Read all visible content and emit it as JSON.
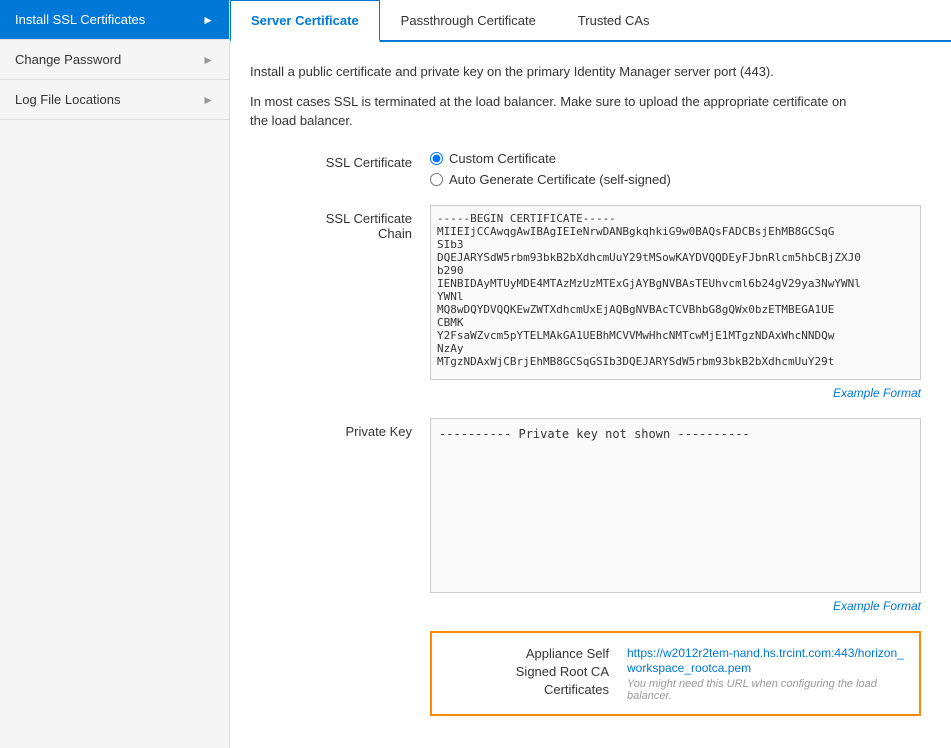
{
  "sidebar": {
    "items": [
      {
        "label": "Install SSL Certificates",
        "active": true
      },
      {
        "label": "Change Password",
        "active": false
      },
      {
        "label": "Log File Locations",
        "active": false
      }
    ]
  },
  "tabs": [
    {
      "label": "Server Certificate",
      "active": true
    },
    {
      "label": "Passthrough Certificate",
      "active": false
    },
    {
      "label": "Trusted CAs",
      "active": false
    }
  ],
  "description": {
    "line1": "Install a public certificate and private key on the primary Identity Manager server port (443).",
    "line2": "In most cases SSL is terminated at the load balancer. Make sure to upload the appropriate certificate on the load balancer."
  },
  "form": {
    "ssl_certificate_label": "SSL Certificate",
    "radio_custom": "Custom Certificate",
    "radio_auto": "Auto Generate Certificate (self-signed)",
    "ssl_chain_label": "SSL Certificate\nChain",
    "ssl_chain_placeholder": "-----BEGIN CERTIFICATE-----\nMIIEIjCCAwqgAwIBAgIEIeNrwDANBgkqhkiG9w0BAQsFADCBsjEhMB8GCSqG\nSIb3\nDQEJARYSdW5rbm93bkB2bXdhcmUuY29tMSowKAYDVQQDEyFJbnRlcm5hbCBjZXJ0\nb290\nIENBIDAyMTUyMDE4MTAzMzUzMTExGjAYBgNVBAsTEUhvcml6b24gV29ya3NwYWNl\nYWNl\nMQ8wDQYDVQQKEwZWTXdhcmUxEjAQBgNVBAcTCVBhbG8gQWx0bzETMBEGA1UE\nCBMK\nY2FsaWZvcm5pYTELMAkGA1UEBhMCVVMwHhcNMTcwMjE1MTgzNDAxWhcNNDQw\nNzAy\nMTgzNDAxWjCBrjEhMB8GCSqGSIb3DQEJARYSdW5rbm93bkB2bXdhcmUuY29t",
    "private_key_label": "Private Key",
    "private_key_placeholder": "---------- Private key not shown ----------",
    "example_format_label": "Example Format",
    "appliance_label": "Appliance Self\nSigned Root CA\nCertificates",
    "appliance_url": "https://w2012r2tem-nand.hs.trcint.com:443/horizon_workspace_rootca.pem",
    "appliance_hint": "You might need this URL when configuring the load balancer."
  }
}
